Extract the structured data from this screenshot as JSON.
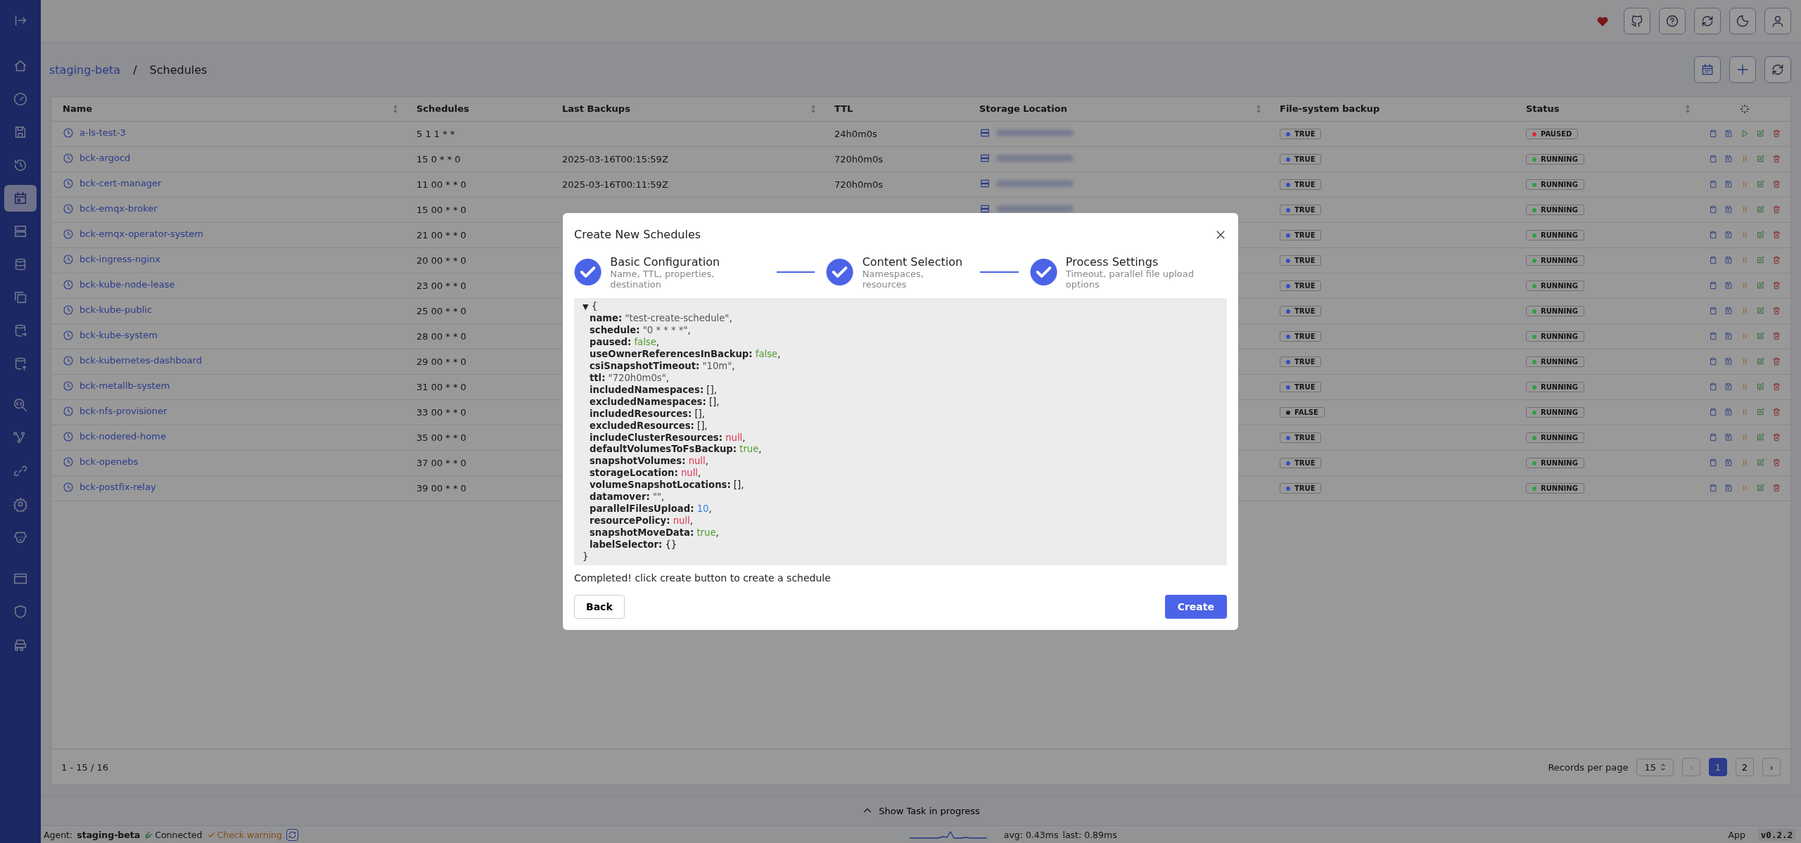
{
  "sidebar": {
    "items": [
      {
        "selected": false
      },
      {
        "selected": false
      },
      {
        "selected": false
      },
      {
        "selected": false
      },
      {
        "selected": false
      },
      {
        "selected": true
      },
      {
        "selected": false
      },
      {
        "selected": false
      },
      {
        "selected": false
      },
      {
        "selected": false
      },
      {
        "selected": false
      },
      {
        "selected": false
      },
      {
        "selected": false
      },
      {
        "selected": false
      },
      {
        "selected": false
      },
      {
        "selected": false
      },
      {
        "selected": false
      },
      {
        "selected": false
      },
      {
        "selected": false
      }
    ]
  },
  "breadcrumb": [
    "staging-beta",
    "/",
    "Schedules"
  ],
  "table": {
    "columns": [
      "Name",
      "Schedules",
      "Last Backups",
      "TTL",
      "Storage Location",
      "File-system backup",
      "Status"
    ],
    "rows": [
      {
        "name": "a-ls-test-3",
        "schedule": "5 1 1 * *",
        "last_backup": "",
        "ttl": "24h0m0s",
        "storage": {
          "kind": "blurred"
        },
        "fs_backup": {
          "text": "TRUE",
          "color": "#3b4cc0"
        },
        "status": {
          "text": "PAUSED",
          "color": "#d92d3a",
          "kind": "paused"
        }
      },
      {
        "name": "bck-argocd",
        "schedule": "15 0 * * 0",
        "last_backup": "2025-03-16T00:15:59Z",
        "ttl": "720h0m0s",
        "storage": {
          "kind": "blurred"
        },
        "fs_backup": {
          "text": "TRUE",
          "color": "#3b4cc0"
        },
        "status": {
          "text": "RUNNING",
          "color": "#2f9e44",
          "kind": "running"
        }
      },
      {
        "name": "bck-cert-manager",
        "schedule": "11 00 * * 0",
        "last_backup": "2025-03-16T00:11:59Z",
        "ttl": "720h0m0s",
        "storage": {
          "kind": "blurred"
        },
        "fs_backup": {
          "text": "TRUE",
          "color": "#3b4cc0"
        },
        "status": {
          "text": "RUNNING",
          "color": "#2f9e44",
          "kind": "running"
        }
      },
      {
        "name": "bck-emqx-broker",
        "schedule": "15 00 * * 0",
        "storage": {
          "kind": "blurred"
        },
        "fs_backup": {
          "text": "TRUE",
          "color": "#3b4cc0"
        },
        "status": {
          "text": "RUNNING",
          "color": "#2f9e44",
          "kind": "running"
        }
      },
      {
        "name": "bck-emqx-operator-system",
        "schedule": "21 00 * * 0",
        "fs_backup": {
          "text": "TRUE",
          "color": "#3b4cc0"
        },
        "status": {
          "text": "RUNNING",
          "color": "#2f9e44",
          "kind": "running"
        }
      },
      {
        "name": "bck-ingress-nginx",
        "schedule": "20 00 * * 0",
        "fs_backup": {
          "text": "TRUE",
          "color": "#3b4cc0"
        },
        "status": {
          "text": "RUNNING",
          "color": "#2f9e44",
          "kind": "running"
        }
      },
      {
        "name": "bck-kube-node-lease",
        "schedule": "23 00 * * 0",
        "fs_backup": {
          "text": "TRUE",
          "color": "#3b4cc0"
        },
        "status": {
          "text": "RUNNING",
          "color": "#2f9e44",
          "kind": "running"
        }
      },
      {
        "name": "bck-kube-public",
        "schedule": "25 00 * * 0",
        "fs_backup": {
          "text": "TRUE",
          "color": "#3b4cc0"
        },
        "status": {
          "text": "RUNNING",
          "color": "#2f9e44",
          "kind": "running"
        }
      },
      {
        "name": "bck-kube-system",
        "schedule": "28 00 * * 0",
        "fs_backup": {
          "text": "TRUE",
          "color": "#3b4cc0"
        },
        "status": {
          "text": "RUNNING",
          "color": "#2f9e44",
          "kind": "running"
        }
      },
      {
        "name": "bck-kubernetes-dashboard",
        "schedule": "29 00 * * 0",
        "fs_backup": {
          "text": "TRUE",
          "color": "#3b4cc0"
        },
        "status": {
          "text": "RUNNING",
          "color": "#2f9e44",
          "kind": "running"
        }
      },
      {
        "name": "bck-metallb-system",
        "schedule": "31 00 * * 0",
        "fs_backup": {
          "text": "TRUE",
          "color": "#3b4cc0"
        },
        "status": {
          "text": "RUNNING",
          "color": "#2f9e44",
          "kind": "running"
        }
      },
      {
        "name": "bck-nfs-provisioner",
        "schedule": "33 00 * * 0",
        "fs_backup": {
          "text": "FALSE",
          "color": "#222222"
        },
        "status": {
          "text": "RUNNING",
          "color": "#2f9e44",
          "kind": "running"
        }
      },
      {
        "name": "bck-nodered-home",
        "schedule": "35 00 * * 0",
        "fs_backup": {
          "text": "TRUE",
          "color": "#3b4cc0"
        },
        "status": {
          "text": "RUNNING",
          "color": "#2f9e44",
          "kind": "running"
        }
      },
      {
        "name": "bck-openebs",
        "schedule": "37 00 * * 0",
        "fs_backup": {
          "text": "TRUE",
          "color": "#3b4cc0"
        },
        "status": {
          "text": "RUNNING",
          "color": "#2f9e44",
          "kind": "running"
        }
      },
      {
        "name": "bck-postfix-relay",
        "schedule": "39 00 * * 0",
        "fs_backup": {
          "text": "TRUE",
          "color": "#3b4cc0"
        },
        "status": {
          "text": "RUNNING",
          "color": "#2f9e44",
          "kind": "running"
        }
      }
    ]
  },
  "pagination": {
    "range": "1 - 15 / 16",
    "records_label": "Records per page",
    "per_page": "15",
    "prev": "‹",
    "next": "›",
    "pages": [
      {
        "label": "1",
        "selected": true
      },
      {
        "label": "2",
        "selected": false
      }
    ]
  },
  "task_bar": "Show Task in progress",
  "status_bar": {
    "agent_label": "Agent:",
    "agent": "staging-beta",
    "connected": "Connected",
    "warning": "Check warning",
    "avg": "avg: 0.43ms",
    "last": "last: 0.89ms",
    "app": "App",
    "version": "v0.2.2"
  },
  "modal": {
    "title": "Create New Schedules",
    "steps": [
      {
        "title": "Basic Configuration",
        "subtitle": "Name, TTL, properties, destination",
        "done": true
      },
      {
        "title": "Content Selection",
        "subtitle": "Namespaces, resources",
        "done": true
      },
      {
        "title": "Process Settings",
        "subtitle": "Timeout, parallel file upload options",
        "done": true
      }
    ],
    "object": {
      "toggle": "▼",
      "open": "{",
      "close": "}",
      "fields": [
        {
          "key": "name:",
          "value": "\"test-create-schedule\"",
          "kind": "string",
          "sep": ","
        },
        {
          "key": "schedule:",
          "value": "\"0 * * * *\"",
          "kind": "string",
          "sep": ","
        },
        {
          "key": "paused:",
          "value": "false",
          "kind": "boolean",
          "sep": ","
        },
        {
          "key": "useOwnerReferencesInBackup:",
          "value": "false",
          "kind": "boolean",
          "sep": ","
        },
        {
          "key": "csiSnapshotTimeout:",
          "value": "\"10m\"",
          "kind": "string",
          "sep": ","
        },
        {
          "key": "ttl:",
          "value": "\"720h0m0s\"",
          "kind": "string",
          "sep": ","
        },
        {
          "key": "includedNamespaces:",
          "value": "[]",
          "kind": "plain",
          "sep": ","
        },
        {
          "key": "excludedNamespaces:",
          "value": "[]",
          "kind": "plain",
          "sep": ","
        },
        {
          "key": "includedResources:",
          "value": "[]",
          "kind": "plain",
          "sep": ","
        },
        {
          "key": "excludedResources:",
          "value": "[]",
          "kind": "plain",
          "sep": ","
        },
        {
          "key": "includeClusterResources:",
          "value": "null",
          "kind": "null",
          "sep": ","
        },
        {
          "key": "defaultVolumesToFsBackup:",
          "value": "true",
          "kind": "boolean",
          "sep": ","
        },
        {
          "key": "snapshotVolumes:",
          "value": "null",
          "kind": "null",
          "sep": ","
        },
        {
          "key": "storageLocation:",
          "value": "null",
          "kind": "null",
          "sep": ","
        },
        {
          "key": "volumeSnapshotLocations:",
          "value": "[]",
          "kind": "plain",
          "sep": ","
        },
        {
          "key": "datamover:",
          "value": "\"\"",
          "kind": "string",
          "sep": ","
        },
        {
          "key": "parallelFilesUpload:",
          "value": "10",
          "kind": "number",
          "sep": ","
        },
        {
          "key": "resourcePolicy:",
          "value": "null",
          "kind": "null",
          "sep": ","
        },
        {
          "key": "snapshotMoveData:",
          "value": "true",
          "kind": "boolean",
          "sep": ","
        },
        {
          "key": "labelSelector:",
          "value": "{}",
          "kind": "plain"
        }
      ]
    },
    "message": "Completed! click create button to create a schedule",
    "back": "Back",
    "create": "Create"
  }
}
